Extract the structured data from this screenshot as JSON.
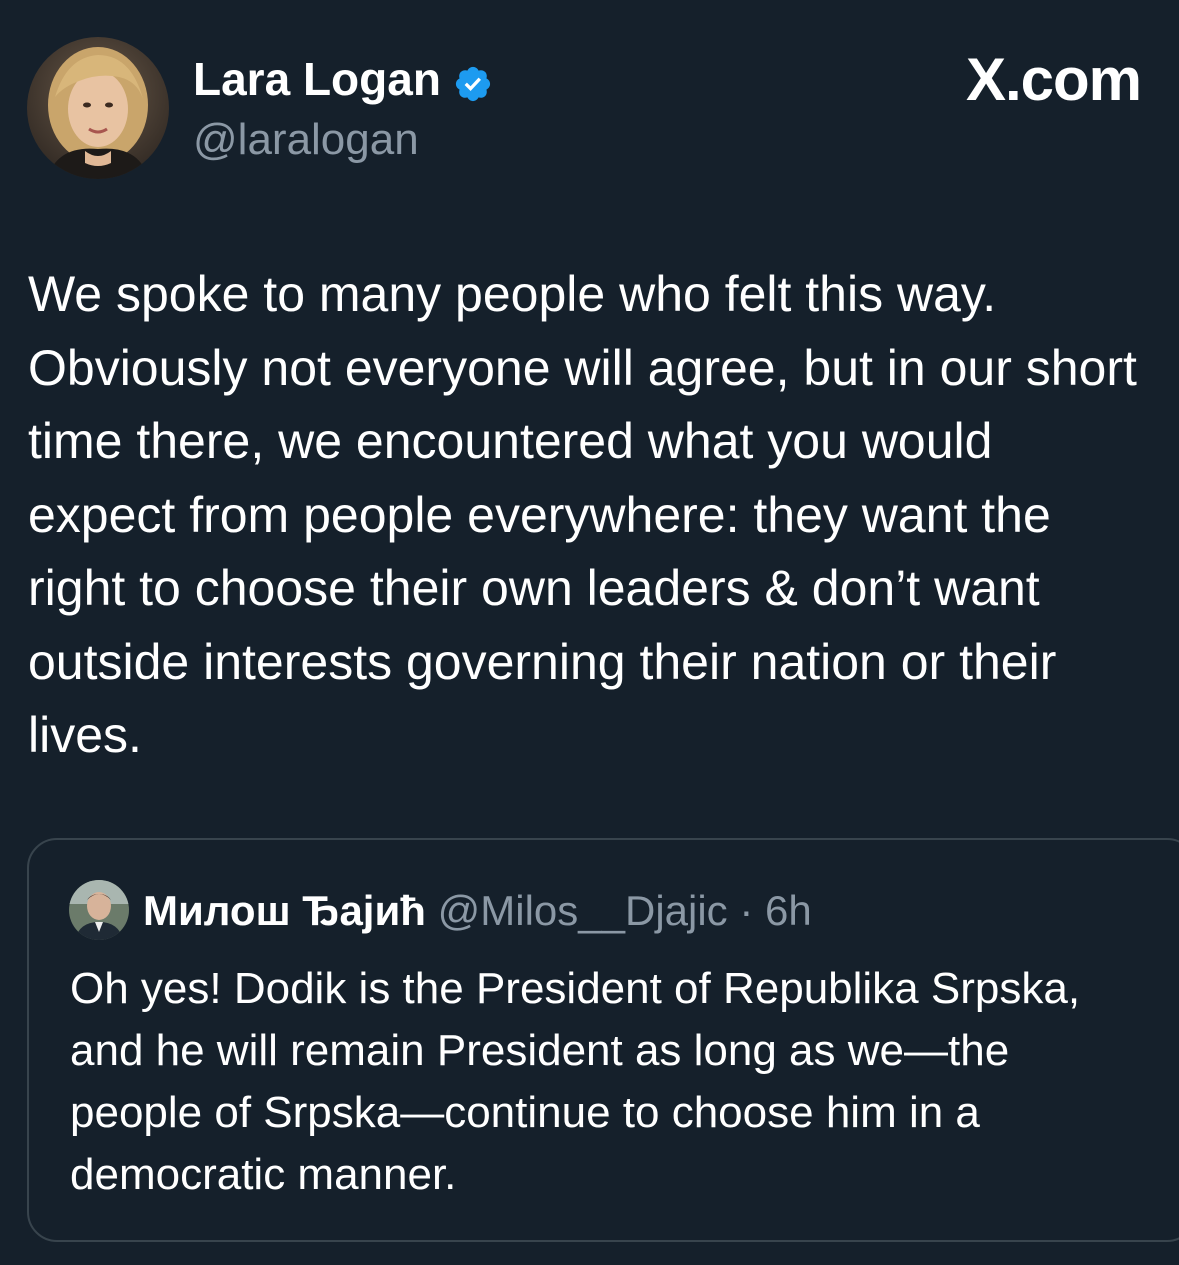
{
  "tweet": {
    "author": {
      "name": "Lara Logan",
      "handle": "@laralogan",
      "verified": true
    },
    "text": "We spoke to many people who felt this way. Obviously not everyone will agree, but in our short time there, we encountered what you would expect from people everywhere: they want the right to choose their own leaders & don’t want outside interests governing their nation or their lives."
  },
  "brand": {
    "label": "X.com"
  },
  "quoted_tweet": {
    "author": {
      "name": "Милош Ђајић",
      "handle": "@Milos__Djajic"
    },
    "separator": "·",
    "time": "6h",
    "text": "Oh yes! Dodik is the President of Republika Srpska, and he will remain President as long as we—the people of Srpska—continue to choose him in a democratic manner."
  },
  "colors": {
    "background": "#15202b",
    "text_primary": "#ffffff",
    "text_secondary": "#8b98a5",
    "verified_badge": "#1d9bf0",
    "card_border": "#38444d"
  },
  "icons": {
    "verified": "verified-badge-icon",
    "brand": "x-logo-icon"
  }
}
